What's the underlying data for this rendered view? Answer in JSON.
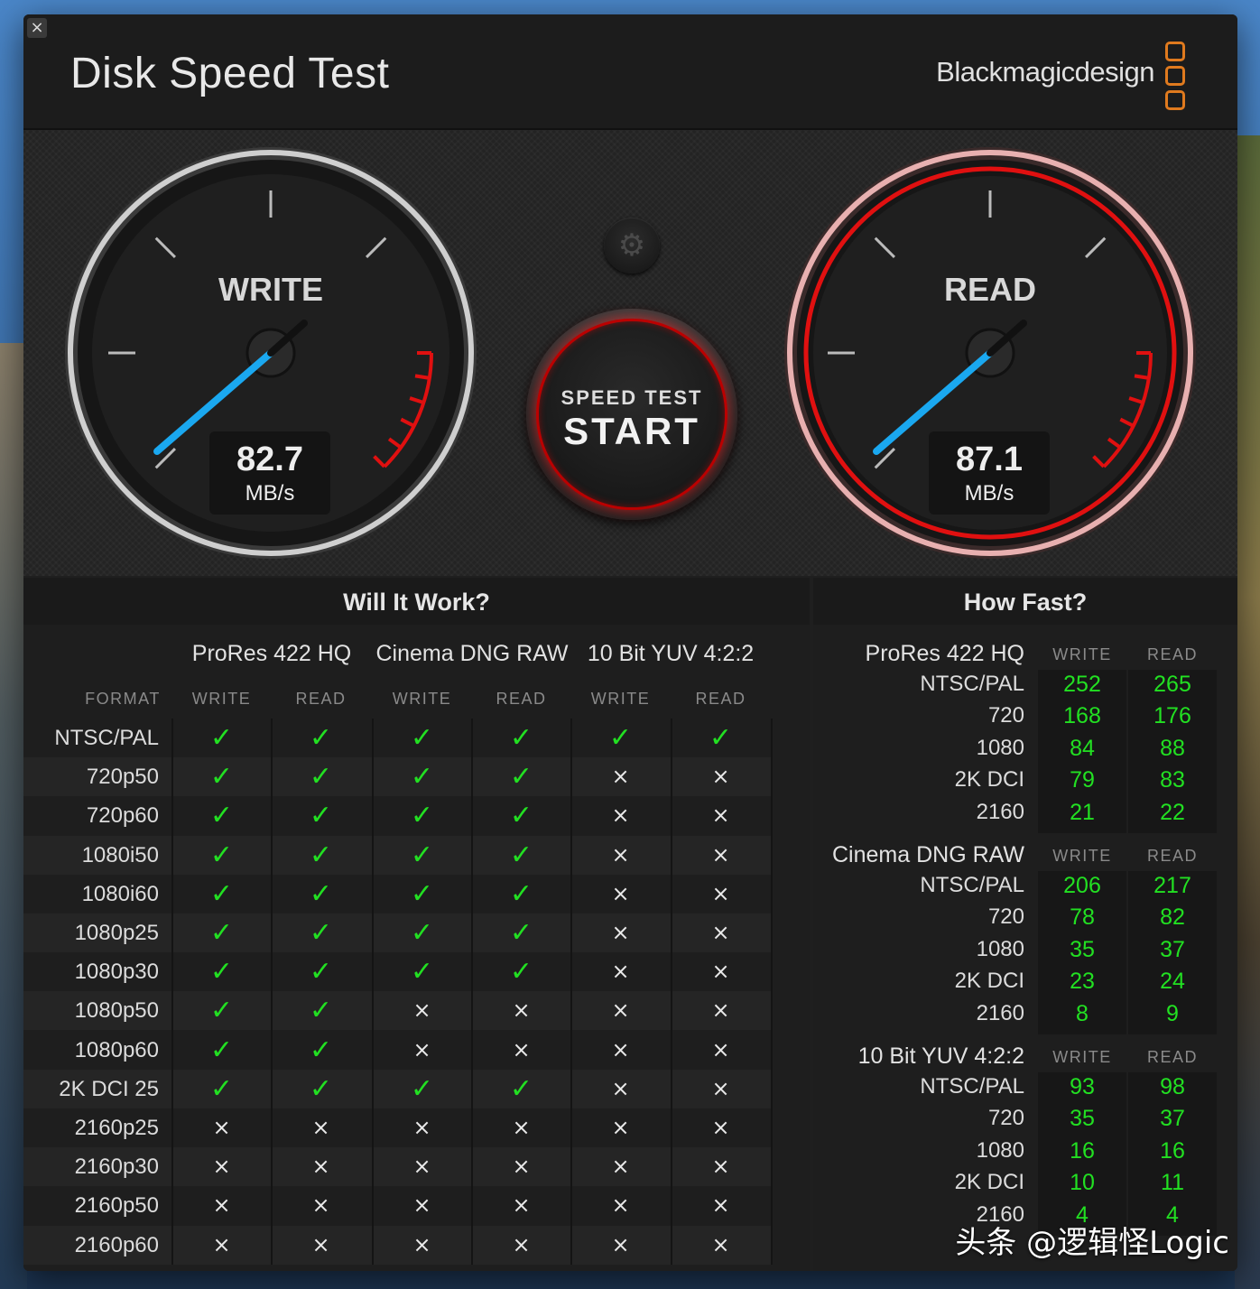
{
  "window": {
    "close_label": "×",
    "title": "Disk Speed Test",
    "brand": "Blackmagicdesign"
  },
  "gauges": {
    "write": {
      "label": "WRITE",
      "value": "82.7",
      "unit": "MB/s"
    },
    "read": {
      "label": "READ",
      "value": "87.1",
      "unit": "MB/s"
    }
  },
  "start_button": {
    "small": "SPEED TEST",
    "big": "START"
  },
  "settings_icon": "gear-icon",
  "will_it_work": {
    "title": "Will It Work?",
    "format_header": "FORMAT",
    "codecs": [
      {
        "name": "ProRes 422 HQ",
        "write": "WRITE",
        "read": "READ"
      },
      {
        "name": "Cinema DNG RAW",
        "write": "WRITE",
        "read": "READ"
      },
      {
        "name": "10 Bit YUV 4:2:2",
        "write": "WRITE",
        "read": "READ"
      }
    ],
    "rows": [
      {
        "format": "NTSC/PAL",
        "cells": [
          1,
          1,
          1,
          1,
          1,
          1
        ]
      },
      {
        "format": "720p50",
        "cells": [
          1,
          1,
          1,
          1,
          0,
          0
        ]
      },
      {
        "format": "720p60",
        "cells": [
          1,
          1,
          1,
          1,
          0,
          0
        ]
      },
      {
        "format": "1080i50",
        "cells": [
          1,
          1,
          1,
          1,
          0,
          0
        ]
      },
      {
        "format": "1080i60",
        "cells": [
          1,
          1,
          1,
          1,
          0,
          0
        ]
      },
      {
        "format": "1080p25",
        "cells": [
          1,
          1,
          1,
          1,
          0,
          0
        ]
      },
      {
        "format": "1080p30",
        "cells": [
          1,
          1,
          1,
          1,
          0,
          0
        ]
      },
      {
        "format": "1080p50",
        "cells": [
          1,
          1,
          0,
          0,
          0,
          0
        ]
      },
      {
        "format": "1080p60",
        "cells": [
          1,
          1,
          0,
          0,
          0,
          0
        ]
      },
      {
        "format": "2K DCI 25",
        "cells": [
          1,
          1,
          1,
          1,
          0,
          0
        ]
      },
      {
        "format": "2160p25",
        "cells": [
          0,
          0,
          0,
          0,
          0,
          0
        ]
      },
      {
        "format": "2160p30",
        "cells": [
          0,
          0,
          0,
          0,
          0,
          0
        ]
      },
      {
        "format": "2160p50",
        "cells": [
          0,
          0,
          0,
          0,
          0,
          0
        ]
      },
      {
        "format": "2160p60",
        "cells": [
          0,
          0,
          0,
          0,
          0,
          0
        ]
      }
    ],
    "yes_glyph": "✓",
    "no_glyph": "×"
  },
  "how_fast": {
    "title": "How Fast?",
    "groups": [
      {
        "name": "ProRes 422 HQ",
        "write": "WRITE",
        "read": "READ",
        "rows": [
          {
            "label": "NTSC/PAL",
            "write": "252",
            "read": "265"
          },
          {
            "label": "720",
            "write": "168",
            "read": "176"
          },
          {
            "label": "1080",
            "write": "84",
            "read": "88"
          },
          {
            "label": "2K DCI",
            "write": "79",
            "read": "83"
          },
          {
            "label": "2160",
            "write": "21",
            "read": "22"
          }
        ]
      },
      {
        "name": "Cinema DNG RAW",
        "write": "WRITE",
        "read": "READ",
        "rows": [
          {
            "label": "NTSC/PAL",
            "write": "206",
            "read": "217"
          },
          {
            "label": "720",
            "write": "78",
            "read": "82"
          },
          {
            "label": "1080",
            "write": "35",
            "read": "37"
          },
          {
            "label": "2K DCI",
            "write": "23",
            "read": "24"
          },
          {
            "label": "2160",
            "write": "8",
            "read": "9"
          }
        ]
      },
      {
        "name": "10 Bit YUV 4:2:2",
        "write": "WRITE",
        "read": "READ",
        "rows": [
          {
            "label": "NTSC/PAL",
            "write": "93",
            "read": "98"
          },
          {
            "label": "720",
            "write": "35",
            "read": "37"
          },
          {
            "label": "1080",
            "write": "16",
            "read": "16"
          },
          {
            "label": "2K DCI",
            "write": "10",
            "read": "11"
          },
          {
            "label": "2160",
            "write": "4",
            "read": "4"
          }
        ]
      }
    ]
  },
  "watermark": "头条 @逻辑怪Logic",
  "colors": {
    "accent_green": "#22e022",
    "accent_red": "#e01010",
    "blue_needle": "#1aa8f0",
    "brand_orange": "#e07a1e"
  }
}
